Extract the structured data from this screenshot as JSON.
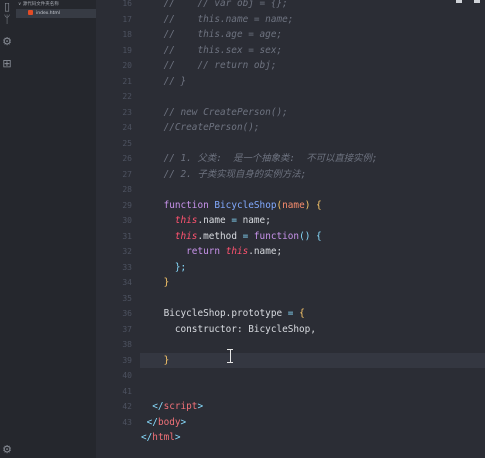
{
  "explorer": {
    "folder_label": "∨ 源代码文件夹名称",
    "file_label": "index.html"
  },
  "gutter": [
    "16",
    "17",
    "18",
    "19",
    "20",
    "21",
    "22",
    "23",
    "24",
    "25",
    "26",
    "27",
    "28",
    "29",
    "30",
    "31",
    "32",
    "33",
    "34",
    "35",
    "36",
    "37",
    "38",
    "39",
    "40",
    "41",
    "42",
    "43"
  ],
  "active_line_index": 23,
  "cursor_position": "line 39",
  "code_lines": [
    [
      {
        "t": "    //    // var obj = {};",
        "c": "com"
      }
    ],
    [
      {
        "t": "    //    this.name = name;",
        "c": "com"
      }
    ],
    [
      {
        "t": "    //    this.age = age;",
        "c": "com"
      }
    ],
    [
      {
        "t": "    //    this.sex = sex;",
        "c": "com"
      }
    ],
    [
      {
        "t": "    //    // return obj;",
        "c": "com"
      }
    ],
    [
      {
        "t": "    // }",
        "c": "com"
      }
    ],
    [],
    [
      {
        "t": "    // new CreatePerson();",
        "c": "com"
      }
    ],
    [
      {
        "t": "    //CreatePerson();",
        "c": "com"
      }
    ],
    [],
    [
      {
        "t": "    // 1. 父类:  是一个抽象类:  不可以直接实例;",
        "c": "com"
      }
    ],
    [
      {
        "t": "    // 2. 子类实现自身的实例方法;",
        "c": "com"
      }
    ],
    [],
    [
      {
        "t": "    ",
        "c": "txt"
      },
      {
        "t": "function",
        "c": "kw"
      },
      {
        "t": " ",
        "c": "txt"
      },
      {
        "t": "BicycleShop",
        "c": "fn"
      },
      {
        "t": "(",
        "c": "paren"
      },
      {
        "t": "name",
        "c": "param"
      },
      {
        "t": ")",
        "c": "paren"
      },
      {
        "t": " {",
        "c": "paren"
      }
    ],
    [
      {
        "t": "      ",
        "c": "txt"
      },
      {
        "t": "this",
        "c": "this"
      },
      {
        "t": ".name",
        "c": "txt"
      },
      {
        "t": " = ",
        "c": "punc"
      },
      {
        "t": "name;",
        "c": "txt"
      }
    ],
    [
      {
        "t": "      ",
        "c": "txt"
      },
      {
        "t": "this",
        "c": "this"
      },
      {
        "t": ".method",
        "c": "txt"
      },
      {
        "t": " = ",
        "c": "punc"
      },
      {
        "t": "function",
        "c": "kw"
      },
      {
        "t": "() {",
        "c": "punc"
      }
    ],
    [
      {
        "t": "        ",
        "c": "txt"
      },
      {
        "t": "return",
        "c": "kw"
      },
      {
        "t": " ",
        "c": "txt"
      },
      {
        "t": "this",
        "c": "this"
      },
      {
        "t": ".name;",
        "c": "txt"
      }
    ],
    [
      {
        "t": "      ",
        "c": "txt"
      },
      {
        "t": "};",
        "c": "punc"
      }
    ],
    [
      {
        "t": "    ",
        "c": "txt"
      },
      {
        "t": "}",
        "c": "paren"
      }
    ],
    [],
    [
      {
        "t": "    BicycleShop",
        "c": "txt"
      },
      {
        "t": ".prototype",
        "c": "txt"
      },
      {
        "t": " = ",
        "c": "punc"
      },
      {
        "t": "{",
        "c": "paren"
      }
    ],
    [
      {
        "t": "      constructor: BicycleShop,",
        "c": "txt"
      }
    ],
    [],
    [
      {
        "t": "    ",
        "c": "txt"
      },
      {
        "t": "}",
        "c": "paren"
      }
    ],
    [],
    [],
    [
      {
        "t": "  </",
        "c": "punc"
      },
      {
        "t": "script",
        "c": "tag"
      },
      {
        "t": ">",
        "c": "punc"
      }
    ],
    [
      {
        "t": " </",
        "c": "punc"
      },
      {
        "t": "body",
        "c": "tag"
      },
      {
        "t": ">",
        "c": "punc"
      }
    ],
    [
      {
        "t": "</",
        "c": "punc"
      },
      {
        "t": "html",
        "c": "tag"
      },
      {
        "t": ">",
        "c": "punc"
      }
    ]
  ],
  "icons": {
    "explorer": "files-icon",
    "search": "search-icon",
    "source_control": "source-control-icon",
    "debug": "debug-icon",
    "extensions": "extensions-icon",
    "settings": "gear-icon"
  },
  "colors": {
    "background": "#2b2d35",
    "sidebar": "#25272d",
    "comment": "#6e7380",
    "keyword": "#c792ea",
    "this": "#ff5370",
    "function": "#82aaff",
    "tag": "#f07178"
  }
}
